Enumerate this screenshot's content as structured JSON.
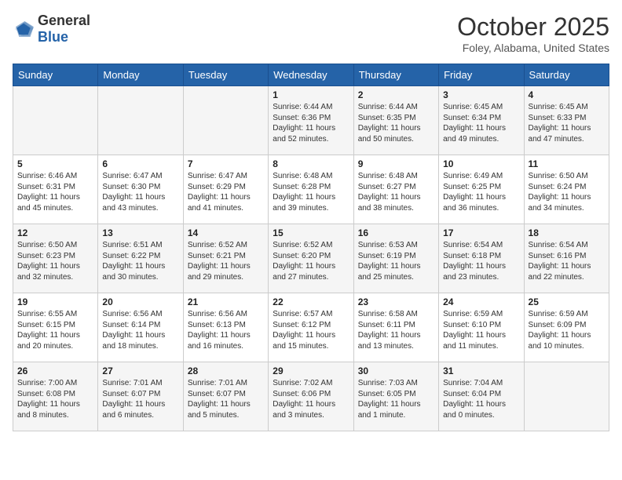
{
  "logo": {
    "general": "General",
    "blue": "Blue"
  },
  "title": "October 2025",
  "location": "Foley, Alabama, United States",
  "days_of_week": [
    "Sunday",
    "Monday",
    "Tuesday",
    "Wednesday",
    "Thursday",
    "Friday",
    "Saturday"
  ],
  "weeks": [
    [
      {
        "day": "",
        "info": ""
      },
      {
        "day": "",
        "info": ""
      },
      {
        "day": "",
        "info": ""
      },
      {
        "day": "1",
        "sunrise": "Sunrise: 6:44 AM",
        "sunset": "Sunset: 6:36 PM",
        "daylight": "Daylight: 11 hours and 52 minutes."
      },
      {
        "day": "2",
        "sunrise": "Sunrise: 6:44 AM",
        "sunset": "Sunset: 6:35 PM",
        "daylight": "Daylight: 11 hours and 50 minutes."
      },
      {
        "day": "3",
        "sunrise": "Sunrise: 6:45 AM",
        "sunset": "Sunset: 6:34 PM",
        "daylight": "Daylight: 11 hours and 49 minutes."
      },
      {
        "day": "4",
        "sunrise": "Sunrise: 6:45 AM",
        "sunset": "Sunset: 6:33 PM",
        "daylight": "Daylight: 11 hours and 47 minutes."
      }
    ],
    [
      {
        "day": "5",
        "sunrise": "Sunrise: 6:46 AM",
        "sunset": "Sunset: 6:31 PM",
        "daylight": "Daylight: 11 hours and 45 minutes."
      },
      {
        "day": "6",
        "sunrise": "Sunrise: 6:47 AM",
        "sunset": "Sunset: 6:30 PM",
        "daylight": "Daylight: 11 hours and 43 minutes."
      },
      {
        "day": "7",
        "sunrise": "Sunrise: 6:47 AM",
        "sunset": "Sunset: 6:29 PM",
        "daylight": "Daylight: 11 hours and 41 minutes."
      },
      {
        "day": "8",
        "sunrise": "Sunrise: 6:48 AM",
        "sunset": "Sunset: 6:28 PM",
        "daylight": "Daylight: 11 hours and 39 minutes."
      },
      {
        "day": "9",
        "sunrise": "Sunrise: 6:48 AM",
        "sunset": "Sunset: 6:27 PM",
        "daylight": "Daylight: 11 hours and 38 minutes."
      },
      {
        "day": "10",
        "sunrise": "Sunrise: 6:49 AM",
        "sunset": "Sunset: 6:25 PM",
        "daylight": "Daylight: 11 hours and 36 minutes."
      },
      {
        "day": "11",
        "sunrise": "Sunrise: 6:50 AM",
        "sunset": "Sunset: 6:24 PM",
        "daylight": "Daylight: 11 hours and 34 minutes."
      }
    ],
    [
      {
        "day": "12",
        "sunrise": "Sunrise: 6:50 AM",
        "sunset": "Sunset: 6:23 PM",
        "daylight": "Daylight: 11 hours and 32 minutes."
      },
      {
        "day": "13",
        "sunrise": "Sunrise: 6:51 AM",
        "sunset": "Sunset: 6:22 PM",
        "daylight": "Daylight: 11 hours and 30 minutes."
      },
      {
        "day": "14",
        "sunrise": "Sunrise: 6:52 AM",
        "sunset": "Sunset: 6:21 PM",
        "daylight": "Daylight: 11 hours and 29 minutes."
      },
      {
        "day": "15",
        "sunrise": "Sunrise: 6:52 AM",
        "sunset": "Sunset: 6:20 PM",
        "daylight": "Daylight: 11 hours and 27 minutes."
      },
      {
        "day": "16",
        "sunrise": "Sunrise: 6:53 AM",
        "sunset": "Sunset: 6:19 PM",
        "daylight": "Daylight: 11 hours and 25 minutes."
      },
      {
        "day": "17",
        "sunrise": "Sunrise: 6:54 AM",
        "sunset": "Sunset: 6:18 PM",
        "daylight": "Daylight: 11 hours and 23 minutes."
      },
      {
        "day": "18",
        "sunrise": "Sunrise: 6:54 AM",
        "sunset": "Sunset: 6:16 PM",
        "daylight": "Daylight: 11 hours and 22 minutes."
      }
    ],
    [
      {
        "day": "19",
        "sunrise": "Sunrise: 6:55 AM",
        "sunset": "Sunset: 6:15 PM",
        "daylight": "Daylight: 11 hours and 20 minutes."
      },
      {
        "day": "20",
        "sunrise": "Sunrise: 6:56 AM",
        "sunset": "Sunset: 6:14 PM",
        "daylight": "Daylight: 11 hours and 18 minutes."
      },
      {
        "day": "21",
        "sunrise": "Sunrise: 6:56 AM",
        "sunset": "Sunset: 6:13 PM",
        "daylight": "Daylight: 11 hours and 16 minutes."
      },
      {
        "day": "22",
        "sunrise": "Sunrise: 6:57 AM",
        "sunset": "Sunset: 6:12 PM",
        "daylight": "Daylight: 11 hours and 15 minutes."
      },
      {
        "day": "23",
        "sunrise": "Sunrise: 6:58 AM",
        "sunset": "Sunset: 6:11 PM",
        "daylight": "Daylight: 11 hours and 13 minutes."
      },
      {
        "day": "24",
        "sunrise": "Sunrise: 6:59 AM",
        "sunset": "Sunset: 6:10 PM",
        "daylight": "Daylight: 11 hours and 11 minutes."
      },
      {
        "day": "25",
        "sunrise": "Sunrise: 6:59 AM",
        "sunset": "Sunset: 6:09 PM",
        "daylight": "Daylight: 11 hours and 10 minutes."
      }
    ],
    [
      {
        "day": "26",
        "sunrise": "Sunrise: 7:00 AM",
        "sunset": "Sunset: 6:08 PM",
        "daylight": "Daylight: 11 hours and 8 minutes."
      },
      {
        "day": "27",
        "sunrise": "Sunrise: 7:01 AM",
        "sunset": "Sunset: 6:07 PM",
        "daylight": "Daylight: 11 hours and 6 minutes."
      },
      {
        "day": "28",
        "sunrise": "Sunrise: 7:01 AM",
        "sunset": "Sunset: 6:07 PM",
        "daylight": "Daylight: 11 hours and 5 minutes."
      },
      {
        "day": "29",
        "sunrise": "Sunrise: 7:02 AM",
        "sunset": "Sunset: 6:06 PM",
        "daylight": "Daylight: 11 hours and 3 minutes."
      },
      {
        "day": "30",
        "sunrise": "Sunrise: 7:03 AM",
        "sunset": "Sunset: 6:05 PM",
        "daylight": "Daylight: 11 hours and 1 minute."
      },
      {
        "day": "31",
        "sunrise": "Sunrise: 7:04 AM",
        "sunset": "Sunset: 6:04 PM",
        "daylight": "Daylight: 11 hours and 0 minutes."
      },
      {
        "day": "",
        "info": ""
      }
    ]
  ]
}
